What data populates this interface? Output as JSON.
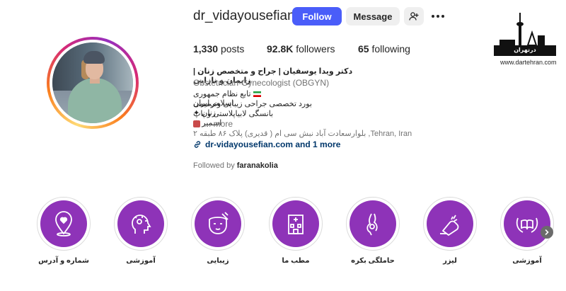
{
  "profile": {
    "username": "dr_vidayousefian",
    "follow_label": "Follow",
    "message_label": "Message"
  },
  "stats": {
    "posts_count": "1,330",
    "posts_label": "posts",
    "followers_count": "92.8K",
    "followers_label": "followers",
    "following_count": "65",
    "following_label": "following"
  },
  "bio": {
    "name": "دکتر ویدا یوسفیان | جراح و متخصص زنان | زایمان و نازایی",
    "category": "Obstetrician-Gynecologist (OBGYN)",
    "line1": "تابع نظام جمهوری اسلامی‌ایران",
    "line2": "بورد تخصصی جراحی زیبایی وترمیمی زنان",
    "line3": "بانسگی لابیاپلاستی و پاپ اسمیر",
    "more_label": "... more",
    "address": "بلوارسعادت آباد نبش سی ام ( قدیری) پلاک ۸۶ طبقه ۲ ,Tehran, Iran",
    "link": "dr-vidayousefian.com and 1 more",
    "followed_prefix": "Followed by",
    "followed_by": "faranakolia"
  },
  "watermark": {
    "label": "درتهران",
    "url": "www.dartehran.com"
  },
  "highlights": [
    {
      "label": "شماره و آدرس",
      "icon": "location-heart-icon"
    },
    {
      "label": "آموزشی",
      "icon": "head-brain-icon"
    },
    {
      "label": "زیبایی",
      "icon": "face-beauty-icon"
    },
    {
      "label": "مطب ما",
      "icon": "clinic-building-icon"
    },
    {
      "label": "حاملگی بکره",
      "icon": "pregnancy-icon"
    },
    {
      "label": "لیزر",
      "icon": "laser-device-icon"
    },
    {
      "label": "آموزشی",
      "icon": "book-laurel-icon"
    }
  ],
  "colors": {
    "follow_button": "#4a5df9",
    "highlight_purple": "#8e33b8",
    "link_blue": "#00376b"
  }
}
